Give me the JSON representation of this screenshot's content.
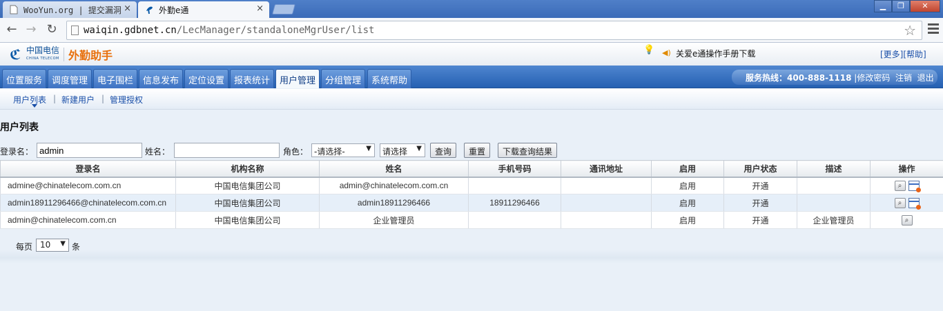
{
  "browser": {
    "tabs": [
      {
        "title": "WooYun.org | 提交漏洞",
        "active": false
      },
      {
        "title": "外勤e通",
        "active": true
      }
    ],
    "url_host": "waiqin.gdbnet.cn",
    "url_path": "/LecManager/standaloneMgrUser/list",
    "close_glyph": "×",
    "win_buttons": [
      "▁",
      "❐",
      "✕"
    ]
  },
  "header": {
    "logo_mark": "ℭ",
    "logo_cn": "中国电信",
    "logo_en": "CHINA TELECOM",
    "app_name": "外勤助手",
    "notice": "关爱e通操作手册下载",
    "more": "[更多]",
    "help": "[帮助]"
  },
  "main_nav": [
    "位置服务",
    "调度管理",
    "电子围栏",
    "信息发布",
    "定位设置",
    "报表统计",
    "用户管理",
    "分组管理",
    "系统帮助"
  ],
  "main_nav_active": 6,
  "hotline": {
    "label": "服务热线：400-888-1118",
    "change_password": "修改密码",
    "logout": "注销",
    "exit": "退出",
    "sep": "|"
  },
  "sub_nav": [
    "用户列表",
    "新建用户",
    "管理授权"
  ],
  "sub_nav_sep": "|",
  "page_title": "用户列表",
  "filters": {
    "login_label": "登录名：",
    "login_value": "admin",
    "name_label": "姓名：",
    "name_value": "",
    "role_label": "角色：",
    "role_value": "-请选择-",
    "second_select_value": "请选择",
    "query_button": "查询",
    "reset_button": "重置",
    "download_button": "下载查询结果",
    "arrow": "▼"
  },
  "table": {
    "columns": [
      "登录名",
      "机构名称",
      "姓名",
      "手机号码",
      "通讯地址",
      "启用",
      "用户状态",
      "描述",
      "操作"
    ],
    "rows": [
      {
        "login": "admine@chinatelecom.com.cn",
        "org": "中国电信集团公司",
        "name": "admin@chinatelecom.com.cn",
        "phone": "",
        "address": "",
        "enabled": "启用",
        "status": "开通",
        "desc": "",
        "can_edit": true
      },
      {
        "login": "admin18911296466@chinatelecom.com.cn",
        "org": "中国电信集团公司",
        "name": "admin18911296466",
        "phone": "18911296466",
        "address": "",
        "enabled": "启用",
        "status": "开通",
        "desc": "",
        "can_edit": true
      },
      {
        "login": "admin@chinatelecom.com.cn",
        "org": "中国电信集团公司",
        "name": "企业管理员",
        "phone": "",
        "address": "",
        "enabled": "启用",
        "status": "开通",
        "desc": "企业管理员",
        "can_edit": false
      }
    ]
  },
  "pager": {
    "per_page_label": "每页",
    "per_page_value": "10",
    "unit": "条"
  }
}
